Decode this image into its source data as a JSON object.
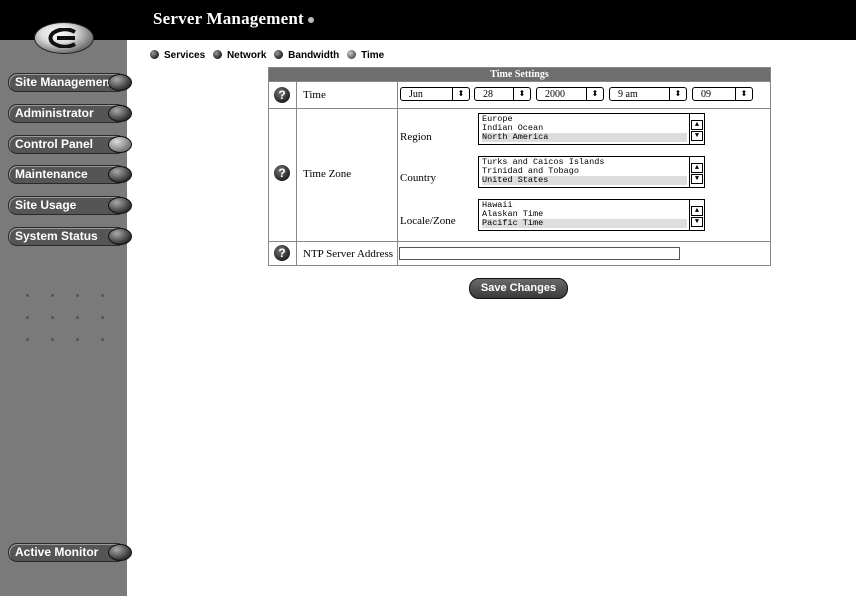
{
  "header": {
    "title": "Server Management"
  },
  "sidebar": {
    "items": [
      {
        "label": "Site Management"
      },
      {
        "label": "Administrator"
      },
      {
        "label": "Control Panel"
      },
      {
        "label": "Maintenance"
      },
      {
        "label": "Site Usage"
      },
      {
        "label": "System Status"
      }
    ],
    "bottom_item": {
      "label": "Active Monitor"
    }
  },
  "tabs": [
    {
      "label": "Services"
    },
    {
      "label": "Network"
    },
    {
      "label": "Bandwidth"
    },
    {
      "label": "Time"
    }
  ],
  "settings": {
    "title": "Time Settings",
    "help_glyph": "?",
    "time": {
      "label": "Time",
      "month": "Jun",
      "day": "28",
      "year": "2000",
      "hour": "9 am",
      "minute": "09",
      "arrow": "⬍"
    },
    "timezone": {
      "label": "Time Zone",
      "region": {
        "label": "Region",
        "options": [
          "Europe",
          "Indian Ocean",
          "North America"
        ]
      },
      "country": {
        "label": "Country",
        "options": [
          "Turks and Caicos Islands",
          "Trinidad and Tobago",
          "United States"
        ]
      },
      "locale": {
        "label": "Locale/Zone",
        "options": [
          "Hawaii",
          "Alaskan Time",
          "Pacific Time"
        ]
      },
      "up_arrow": "▲",
      "down_arrow": "▼"
    },
    "ntp": {
      "label": "NTP Server Address",
      "value": ""
    }
  },
  "actions": {
    "save_label": "Save Changes"
  }
}
